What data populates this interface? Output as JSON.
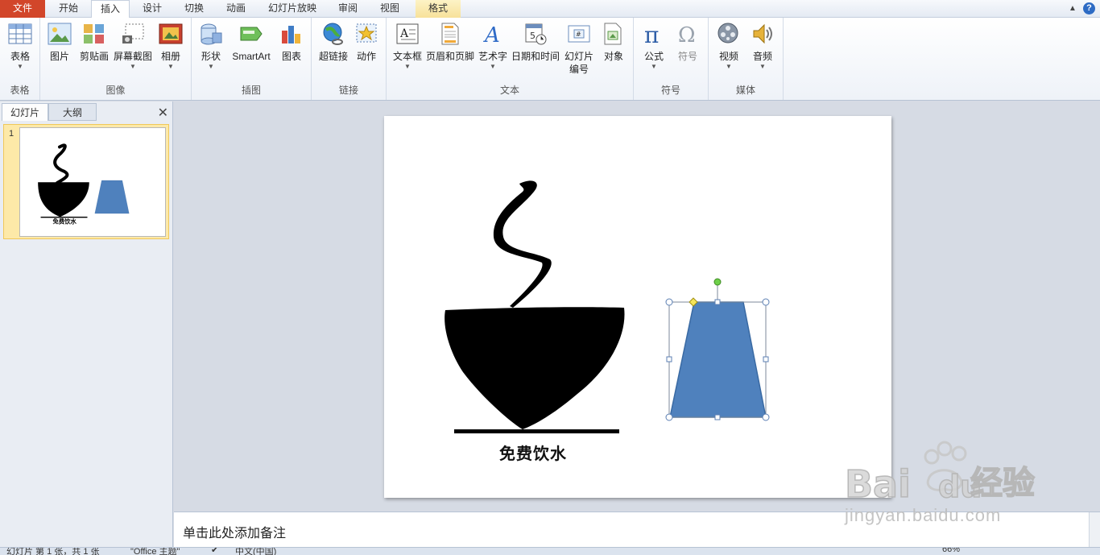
{
  "tabs": [
    {
      "label": "文件"
    },
    {
      "label": "开始"
    },
    {
      "label": "插入"
    },
    {
      "label": "设计"
    },
    {
      "label": "切换"
    },
    {
      "label": "动画"
    },
    {
      "label": "幻灯片放映"
    },
    {
      "label": "审阅"
    },
    {
      "label": "视图"
    },
    {
      "label": "格式"
    }
  ],
  "ribbon": {
    "groups": {
      "table": "表格",
      "image": "图像",
      "illustration": "插图",
      "link": "链接",
      "text": "文本",
      "symbol": "符号",
      "media": "媒体"
    },
    "buttons": {
      "table": "表格",
      "picture": "图片",
      "clipart": "剪贴画",
      "screenshot": "屏幕截图",
      "album": "相册",
      "shape": "形状",
      "smartart": "SmartArt",
      "chart": "图表",
      "hyperlink": "超链接",
      "action": "动作",
      "textbox": "文本框",
      "header_footer": "页眉和页脚",
      "wordart": "艺术字",
      "datetime": "日期和时间",
      "slide_number_1": "幻灯片",
      "slide_number_2": "编号",
      "object": "对象",
      "equation": "公式",
      "symbol": "符号",
      "video": "视频",
      "audio": "音频"
    }
  },
  "pane": {
    "tab_slides": "幻灯片",
    "tab_outline": "大纲",
    "close": "✕",
    "slide_number": "1"
  },
  "slide": {
    "caption": "免费饮水"
  },
  "notes": {
    "placeholder": "单击此处添加备注"
  },
  "status": {
    "slide_info": "幻灯片 第 1 张，共 1 张",
    "theme": "\"Office 主题\"",
    "language": "中文(中国)",
    "zoom": "66%"
  },
  "watermark": {
    "brand": "Bai",
    "brand2": "du",
    "cn": "经验",
    "url": "jingyan.baidu.com"
  },
  "colors": {
    "file_tab": "#d2462a",
    "shape_fill": "#4f81bd",
    "shape_stroke": "#3a6aa3",
    "thumb_selected": "#fde9a8"
  }
}
